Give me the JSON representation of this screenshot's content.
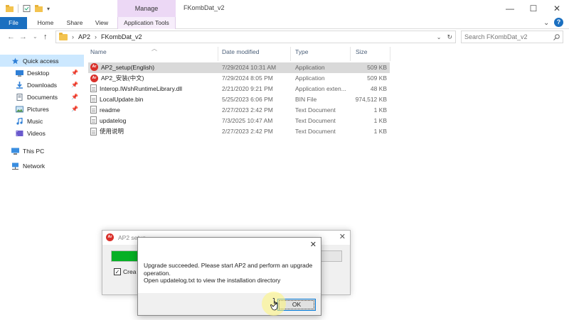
{
  "window": {
    "title": "FKombDat_v2",
    "manage_tab": "Manage",
    "controls": {
      "minimize": "—",
      "maximize": "☐",
      "close": "✕"
    }
  },
  "ribbon": {
    "tabs": [
      "File",
      "Home",
      "Share",
      "View",
      "Application Tools"
    ],
    "help": "?"
  },
  "address": {
    "breadcrumb": [
      "AP2",
      "FKombDat_v2"
    ],
    "search_placeholder": "Search FKombDat_v2"
  },
  "nav": {
    "items": [
      {
        "label": "Quick access",
        "icon": "star-icon",
        "pinned": false,
        "selected": true
      },
      {
        "label": "Desktop",
        "icon": "desktop-icon",
        "pinned": true
      },
      {
        "label": "Downloads",
        "icon": "download-icon",
        "pinned": true
      },
      {
        "label": "Documents",
        "icon": "documents-icon",
        "pinned": true
      },
      {
        "label": "Pictures",
        "icon": "pictures-icon",
        "pinned": true
      },
      {
        "label": "Music",
        "icon": "music-icon",
        "pinned": false
      },
      {
        "label": "Videos",
        "icon": "videos-icon",
        "pinned": false
      },
      {
        "label": "This PC",
        "icon": "pc-icon",
        "pinned": false
      },
      {
        "label": "Network",
        "icon": "network-icon",
        "pinned": false
      }
    ]
  },
  "list": {
    "columns": {
      "name": "Name",
      "date": "Date modified",
      "type": "Type",
      "size": "Size"
    },
    "rows": [
      {
        "name": "AP2_setup(English)",
        "date": "7/29/2024 10:31 AM",
        "type": "Application",
        "size": "509 KB",
        "icon": "app",
        "selected": true
      },
      {
        "name": "AP2_安装(中文)",
        "date": "7/29/2024 8:05 PM",
        "type": "Application",
        "size": "509 KB",
        "icon": "app"
      },
      {
        "name": "Interop.IWshRuntimeLibrary.dll",
        "date": "2/21/2020 9:21 PM",
        "type": "Application exten...",
        "size": "48 KB",
        "icon": "file"
      },
      {
        "name": "LocalUpdate.bin",
        "date": "5/25/2023 6:06 PM",
        "type": "BIN File",
        "size": "974,512 KB",
        "icon": "file"
      },
      {
        "name": "readme",
        "date": "2/27/2023 2:42 PM",
        "type": "Text Document",
        "size": "1 KB",
        "icon": "file"
      },
      {
        "name": "updatelog",
        "date": "7/3/2025 10:47 AM",
        "type": "Text Document",
        "size": "1 KB",
        "icon": "file"
      },
      {
        "name": "使用说明",
        "date": "2/27/2023 2:42 PM",
        "type": "Text Document",
        "size": "1 KB",
        "icon": "file"
      }
    ]
  },
  "setup_window": {
    "title": "AP2 setup",
    "progress": 0.12,
    "checkbox_label": "Crea",
    "checked": true
  },
  "message": {
    "text_lines": [
      "Upgrade succeeded. Please start AP2 and perform an upgrade",
      "operation.",
      "Open updatelog.txt to view the installation directory"
    ],
    "ok_label": "OK"
  },
  "colors": {
    "accent": "#1a6fc0",
    "manage": "#ecd8f5",
    "progress": "#06b025",
    "selection": "#cce8ff"
  }
}
